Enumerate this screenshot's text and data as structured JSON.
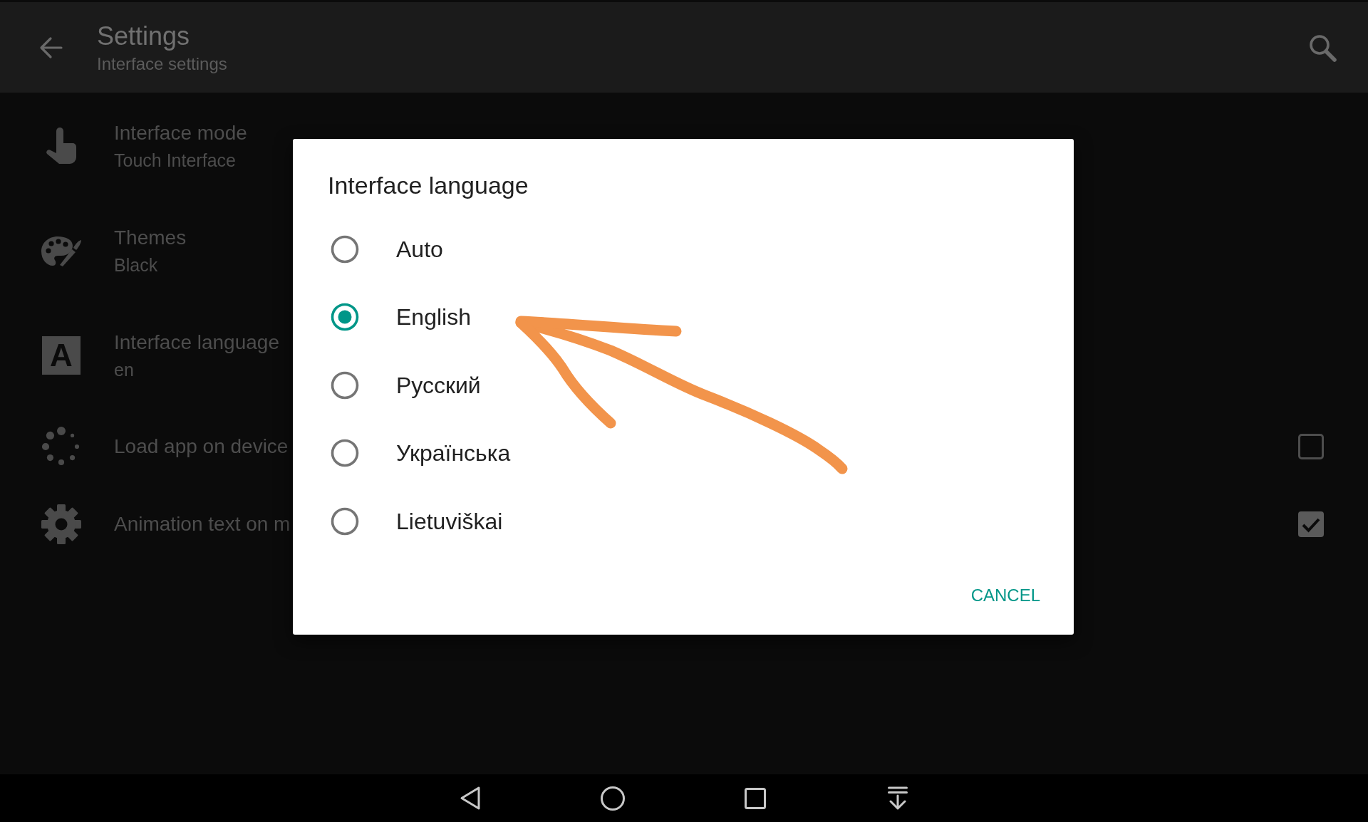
{
  "app_bar": {
    "title": "Settings",
    "subtitle": "Interface settings"
  },
  "settings": [
    {
      "kind": "value",
      "title": "Interface mode",
      "summary": "Touch Interface"
    },
    {
      "kind": "value",
      "title": "Themes",
      "summary": "Black"
    },
    {
      "kind": "value",
      "title": "Interface language",
      "summary": "en",
      "icon_letter": "A"
    },
    {
      "kind": "checkbox",
      "title": "Load app on device",
      "checked": false
    },
    {
      "kind": "checkbox",
      "title": "Animation text on m",
      "checked": true
    }
  ],
  "dialog": {
    "title": "Interface language",
    "options": [
      {
        "label": "Auto",
        "selected": false
      },
      {
        "label": "English",
        "selected": true
      },
      {
        "label": "Русский",
        "selected": false
      },
      {
        "label": "Українська",
        "selected": false
      },
      {
        "label": "Lietuviškai",
        "selected": false
      }
    ],
    "buttons": [
      "CANCEL"
    ]
  },
  "annotations": [
    {
      "kind": "arrow"
    }
  ]
}
